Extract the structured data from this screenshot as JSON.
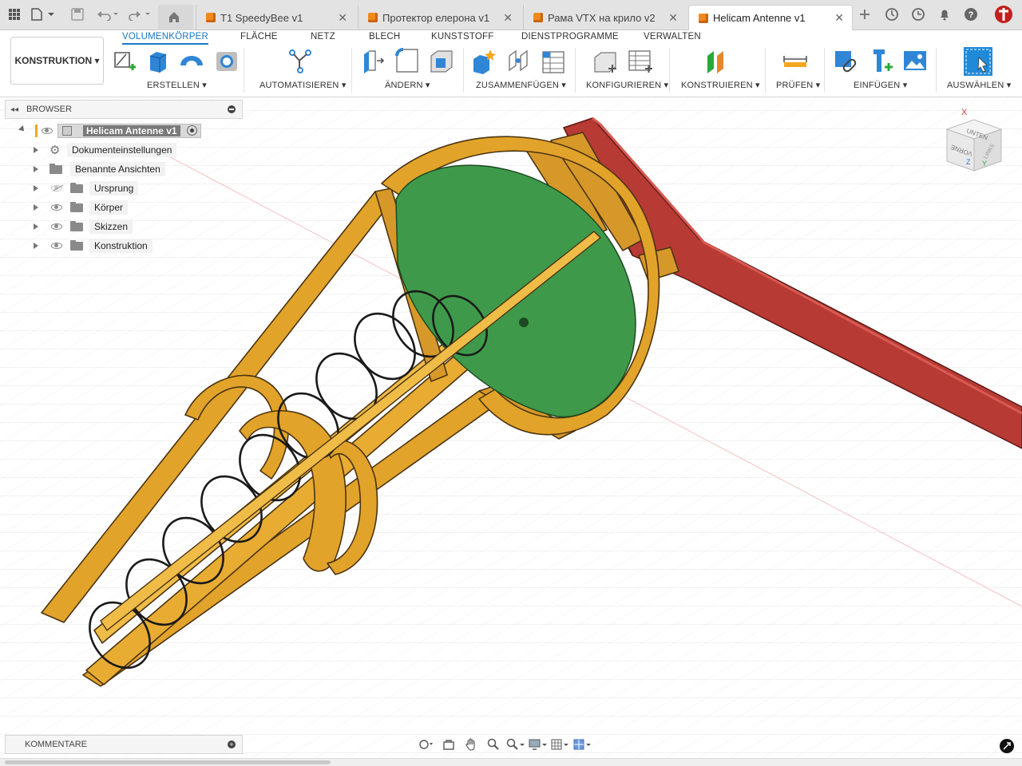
{
  "tabs": [
    {
      "label": "T1 SpeedyBee v1",
      "active": false
    },
    {
      "label": "Протектор елерона v1",
      "active": false
    },
    {
      "label": "Рама VTX на крило v2",
      "active": false
    },
    {
      "label": "Helicam Antenne v1",
      "active": true
    }
  ],
  "workspace": {
    "label": "KONSTRUKTION ▾"
  },
  "ribbon": {
    "tabs": [
      "VOLUMENKÖRPER",
      "FLÄCHE",
      "NETZ",
      "BLECH",
      "KUNSTSTOFF",
      "DIENSTPROGRAMME",
      "VERWALTEN"
    ],
    "groups": [
      "ERSTELLEN ▾",
      "AUTOMATISIEREN ▾",
      "ÄNDERN ▾",
      "ZUSAMMENFÜGEN ▾",
      "KONFIGURIEREN ▾",
      "KONSTRUIEREN ▾",
      "PRÜFEN ▾",
      "EINFÜGEN ▾",
      "AUSWÄHLEN ▾"
    ]
  },
  "browser": {
    "title": "BROWSER",
    "root": "Helicam Antenne v1",
    "items": [
      "Dokumenteinstellungen",
      "Benannte Ansichten",
      "Ursprung",
      "Körper",
      "Skizzen",
      "Konstruktion"
    ]
  },
  "comments": {
    "title": "KOMMENTARE"
  },
  "viewcube": {
    "top": "UNTEN",
    "front": "VORNE",
    "right": "LINKS",
    "axis_x": "X",
    "axis_z": "Z",
    "axis_y": "Y"
  },
  "colors": {
    "body_yellow": "#e2a32a",
    "plate_green": "#3e9a4a",
    "arm_red": "#b83a34",
    "accent_blue": "#1a78c2"
  }
}
